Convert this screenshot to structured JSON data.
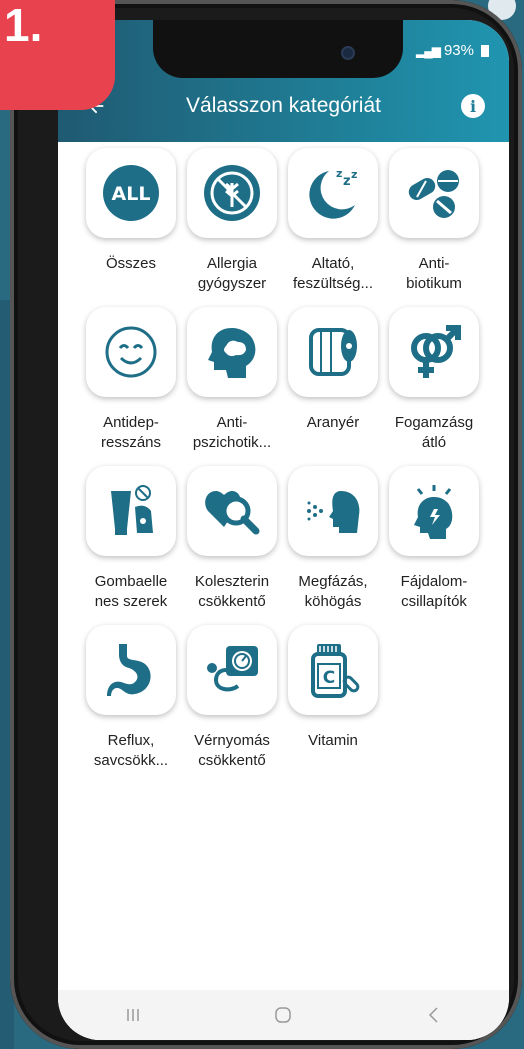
{
  "badge": {
    "text": "1."
  },
  "status": {
    "battery": "93%"
  },
  "appbar": {
    "title": "Válasszon kategóriát"
  },
  "accent_color": "#1f7e96",
  "categories": [
    {
      "label": "Összes",
      "icon": "all-icon"
    },
    {
      "label": "Allergia\ngyógyszer",
      "icon": "no-wheat-icon"
    },
    {
      "label": "Altató,\nfeszültség...",
      "icon": "moon-sleep-icon"
    },
    {
      "label": "Anti-\nbiotikum",
      "icon": "pills-icon"
    },
    {
      "label": "Antidep-\nresszáns",
      "icon": "smiley-icon"
    },
    {
      "label": "Anti-\npszichotik...",
      "icon": "head-brain-icon"
    },
    {
      "label": "Aranyér",
      "icon": "toilet-paper-icon"
    },
    {
      "label": "Fogamzásg\nátló",
      "icon": "gender-symbols-icon"
    },
    {
      "label": "Gombaelle\nnes szerek",
      "icon": "cream-foot-icon"
    },
    {
      "label": "Koleszterin\ncsökkentő",
      "icon": "heart-magnifier-icon"
    },
    {
      "label": "Megfázás,\nköhögás",
      "icon": "sneeze-icon"
    },
    {
      "label": "Fájdalom-\ncsillapítók",
      "icon": "headache-icon"
    },
    {
      "label": "Reflux,\nsavcsökk...",
      "icon": "stomach-icon"
    },
    {
      "label": "Vérnyomás\ncsökkentő",
      "icon": "blood-pressure-icon"
    },
    {
      "label": "Vitamin",
      "icon": "vitamin-bottle-icon"
    }
  ]
}
